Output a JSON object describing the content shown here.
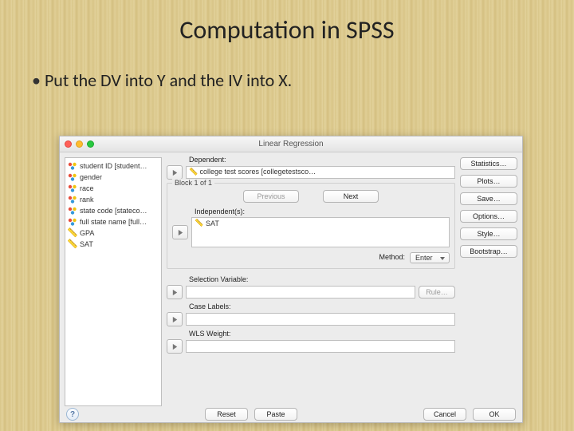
{
  "slide": {
    "title": "Computation in SPSS",
    "bullet": "Put the DV into Y and the IV into X."
  },
  "dialog": {
    "title": "Linear Regression",
    "variables": [
      {
        "name": "student ID [student…",
        "type": "nominal"
      },
      {
        "name": "gender",
        "type": "nominal"
      },
      {
        "name": "race",
        "type": "nominal"
      },
      {
        "name": "rank",
        "type": "nominal"
      },
      {
        "name": "state code [stateco…",
        "type": "nominal"
      },
      {
        "name": "full state name [full…",
        "type": "nominal"
      },
      {
        "name": "GPA",
        "type": "scale"
      },
      {
        "name": "SAT",
        "type": "scale"
      }
    ],
    "dependent_label": "Dependent:",
    "dependent_value": "college test scores [collegetestsco…",
    "block_label": "Block 1 of 1",
    "prev": "Previous",
    "next": "Next",
    "independent_label": "Independent(s):",
    "independent_value": "SAT",
    "method_label": "Method:",
    "method_value": "Enter",
    "selection_label": "Selection Variable:",
    "rule": "Rule…",
    "case_label": "Case Labels:",
    "wls_label": "WLS Weight:",
    "right_buttons": [
      "Statistics…",
      "Plots…",
      "Save…",
      "Options…",
      "Style…",
      "Bootstrap…"
    ],
    "footer": {
      "help": "?",
      "reset": "Reset",
      "paste": "Paste",
      "cancel": "Cancel",
      "ok": "OK"
    }
  }
}
